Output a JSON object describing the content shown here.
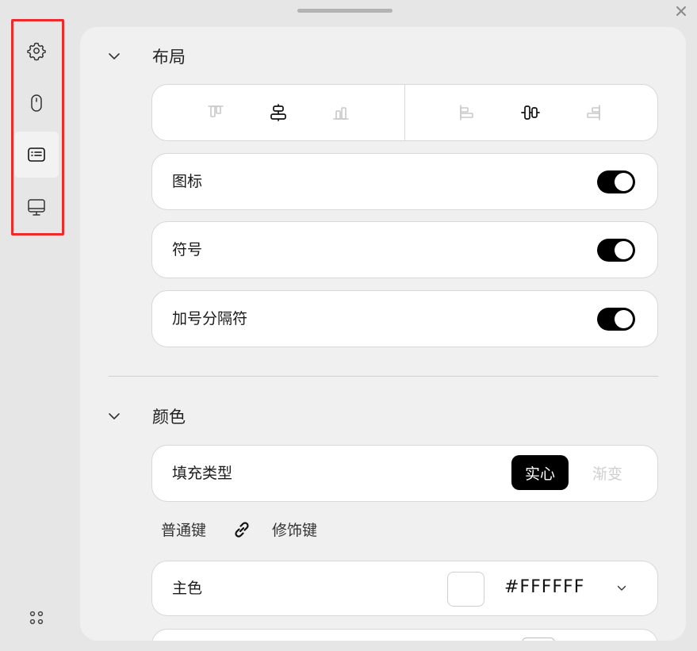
{
  "window": {
    "close_label": "✕"
  },
  "sidebar": {
    "items": [
      {
        "name": "settings",
        "icon": "gear-icon"
      },
      {
        "name": "mouse",
        "icon": "mouse-icon"
      },
      {
        "name": "keyboard",
        "icon": "keyboard-icon",
        "active": true
      },
      {
        "name": "display",
        "icon": "monitor-icon"
      }
    ],
    "bottom_icon": "apps-grid-icon"
  },
  "layout_section": {
    "title": "布局",
    "vertical_align_options": [
      "align-top-icon",
      "align-center-vertical-icon",
      "align-bottom-icon"
    ],
    "vertical_align_selected": 1,
    "horizontal_align_options": [
      "align-left-icon",
      "align-center-horizontal-icon",
      "align-right-icon"
    ],
    "horizontal_align_selected": 1,
    "toggles": [
      {
        "label": "图标",
        "on": true
      },
      {
        "label": "符号",
        "on": true
      },
      {
        "label": "加号分隔符",
        "on": true
      }
    ]
  },
  "color_section": {
    "title": "颜色",
    "fill_type": {
      "label": "填充类型",
      "options": [
        "实心",
        "渐变"
      ],
      "selected": "实心"
    },
    "key_tabs": {
      "normal": "普通键",
      "modifier": "修饰键"
    },
    "primary_color": {
      "label": "主色",
      "value": "#FFFFFF",
      "swatch": "#FFFFFF"
    }
  }
}
